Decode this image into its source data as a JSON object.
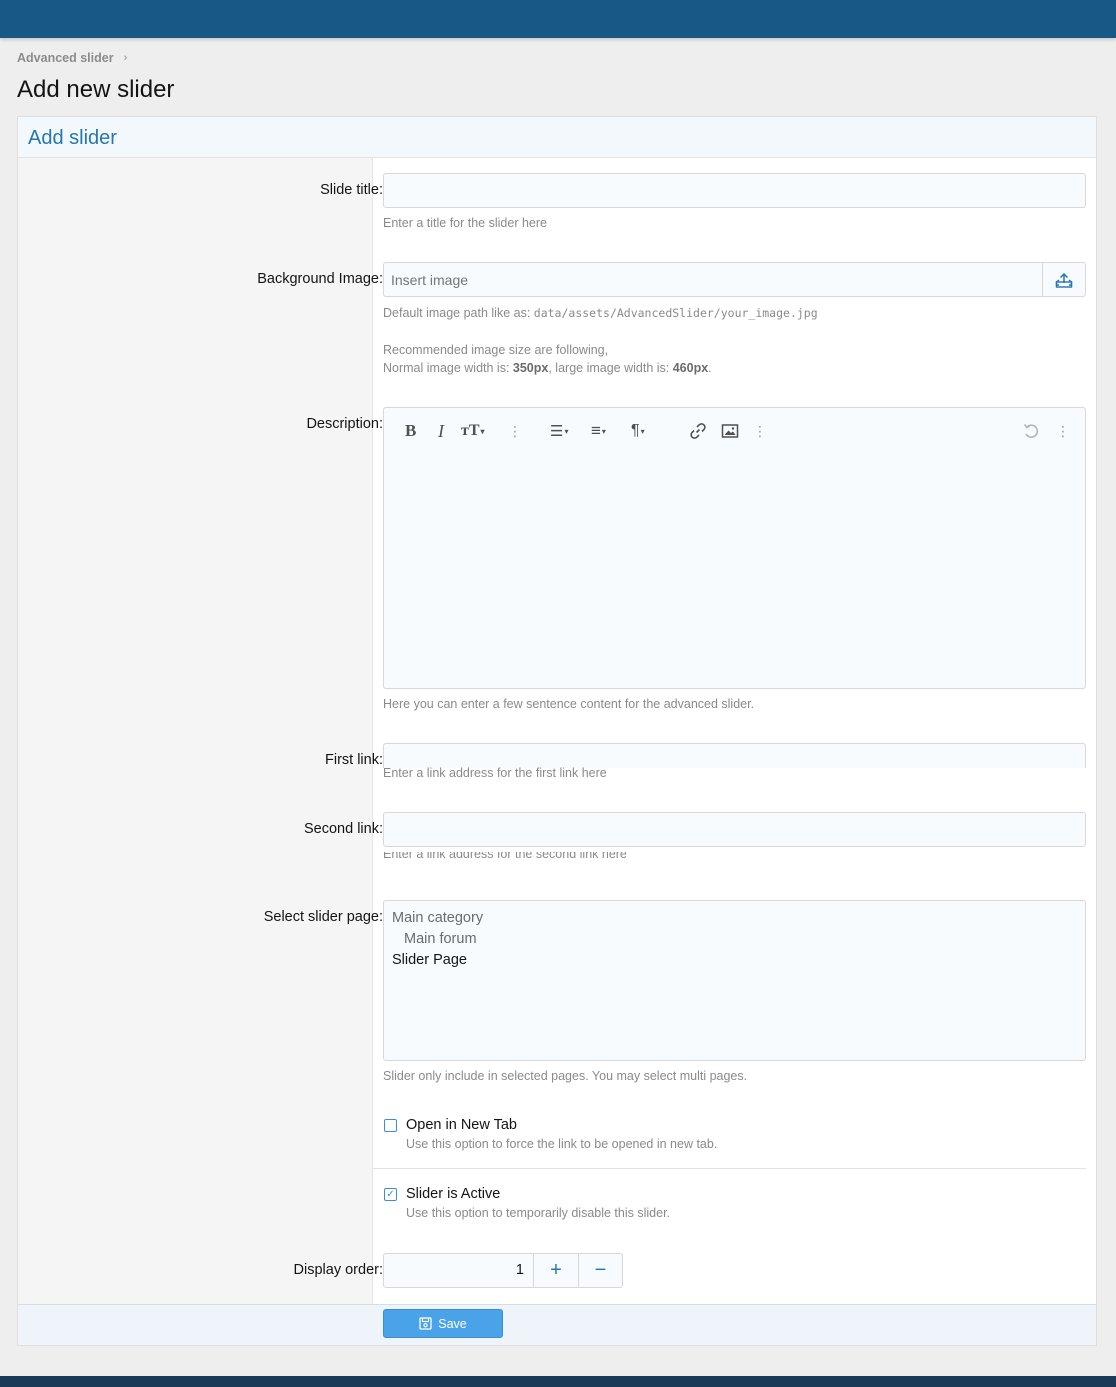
{
  "breadcrumb": {
    "item": "Advanced slider",
    "separator": "›"
  },
  "page": {
    "title": "Add new slider"
  },
  "block": {
    "header": "Add slider"
  },
  "fields": {
    "slide_title": {
      "label": "Slide title:",
      "value": "",
      "hint": "Enter a title for the slider here"
    },
    "background_image": {
      "label": "Background Image:",
      "placeholder": "Insert image",
      "hint_prefix": "Default image path like as: ",
      "hint_path": "data/assets/AdvancedSlider/your_image.jpg",
      "size_line1": "Recommended image size are following,",
      "size_normal_prefix": "Normal image width is: ",
      "size_normal": "350px",
      "size_large_prefix": ", large image width is: ",
      "size_large": "460px",
      "size_end": "."
    },
    "description": {
      "label": "Description:",
      "hint": "Here you can enter a few sentence content for the advanced slider."
    },
    "first_link": {
      "label": "First link:",
      "hint": "Enter a link address for the first link here"
    },
    "second_link": {
      "label": "Second link:",
      "hint": "Enter a link address for the second link here"
    },
    "slider_page": {
      "label": "Select slider page:",
      "options": [
        "Main category",
        "Main forum",
        "Slider Page"
      ],
      "hint": "Slider only include in selected pages. You may select multi pages."
    },
    "open_new_tab": {
      "label": "Open in New Tab",
      "checked": false,
      "hint": "Use this option to force the link to be opened in new tab."
    },
    "slider_active": {
      "label": "Slider is Active",
      "checked": true,
      "check_glyph": "✓",
      "hint": "Use this option to temporarily disable this slider."
    },
    "display_order": {
      "label": "Display order:",
      "value": "1",
      "plus": "+",
      "minus": "−"
    }
  },
  "toolbar": {
    "bold": "B",
    "italic": "I",
    "text_size": "тT",
    "caret": "▾",
    "more": "⋮",
    "list": "☰",
    "align": "≡",
    "paragraph": "¶"
  },
  "save": {
    "label": "Save"
  },
  "colors": {
    "topbar": "#185886",
    "accent": "#2577b1",
    "save_button": "#4aa3e8"
  }
}
